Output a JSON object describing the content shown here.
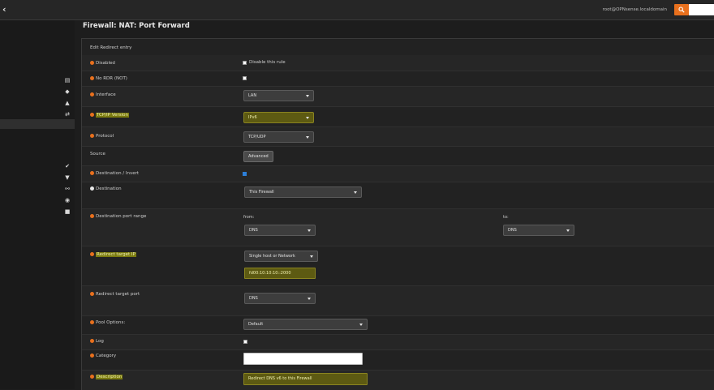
{
  "topbar": {
    "user": "root@OPNsense.localdomain",
    "search_placeholder": ""
  },
  "page": {
    "title": "Firewall: NAT: Port Forward",
    "section_title": "Edit Redirect entry"
  },
  "form": {
    "disabled": {
      "label": "Disabled",
      "checkbox_text": "Disable this rule"
    },
    "no_rdr": {
      "label": "No RDR (NOT)"
    },
    "interface": {
      "label": "Interface",
      "value": "LAN"
    },
    "tcpip_version": {
      "label": "TCP/IP Version",
      "value": "IPv6"
    },
    "protocol": {
      "label": "Protocol",
      "value": "TCP/UDP"
    },
    "source": {
      "label": "Source",
      "button": "Advanced"
    },
    "destination_invert": {
      "label": "Destination / Invert"
    },
    "destination": {
      "label": "Destination",
      "value": "This Firewall"
    },
    "destination_port_range": {
      "label": "Destination port range",
      "from_label": "from:",
      "to_label": "to:",
      "from_value": "DNS",
      "to_value": "DNS"
    },
    "redirect_target_ip": {
      "label": "Redirect target IP",
      "type_value": "Single host or Network",
      "address_value": "fd00:10:10:10::2000"
    },
    "redirect_target_port": {
      "label": "Redirect target port",
      "value": "DNS"
    },
    "pool_options": {
      "label": "Pool Options:",
      "value": "Default"
    },
    "log": {
      "label": "Log"
    },
    "category": {
      "label": "Category",
      "value": ""
    },
    "description": {
      "label": "Description",
      "value": "Redirect DNS v6 to this Firewall"
    }
  }
}
